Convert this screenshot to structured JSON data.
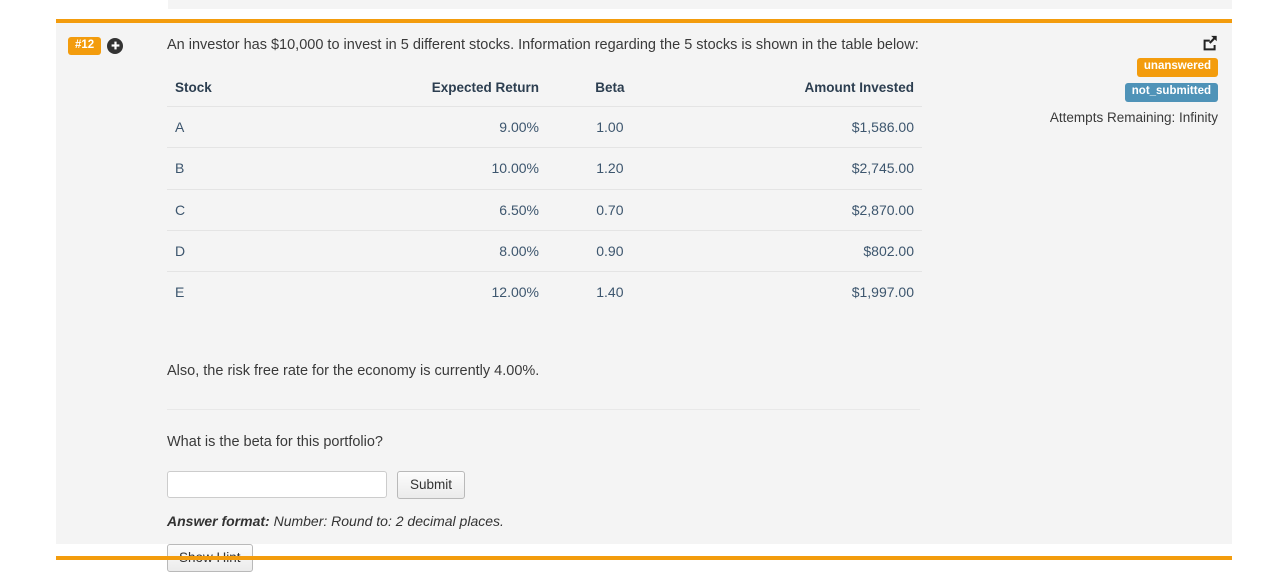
{
  "question": {
    "number_badge": "#12",
    "expand_icon": "plus-circle-icon",
    "intro": "An investor has $10,000 to invest in 5 different stocks. Information regarding the 5 stocks is shown in the table below:",
    "note": "Also, the risk free rate for the economy is currently 4.00%.",
    "prompt": "What is the beta for this portfolio?"
  },
  "table": {
    "headers": [
      "Stock",
      "Expected Return",
      "Beta",
      "Amount Invested"
    ],
    "rows": [
      {
        "stock": "A",
        "expected_return": "9.00%",
        "beta": "1.00",
        "amount_invested": "$1,586.00"
      },
      {
        "stock": "B",
        "expected_return": "10.00%",
        "beta": "1.20",
        "amount_invested": "$2,745.00"
      },
      {
        "stock": "C",
        "expected_return": "6.50%",
        "beta": "0.70",
        "amount_invested": "$2,870.00"
      },
      {
        "stock": "D",
        "expected_return": "8.00%",
        "beta": "0.90",
        "amount_invested": "$802.00"
      },
      {
        "stock": "E",
        "expected_return": "12.00%",
        "beta": "1.40",
        "amount_invested": "$1,997.00"
      }
    ]
  },
  "answer": {
    "input_value": "",
    "input_placeholder": "",
    "submit_label": "Submit",
    "format_label": "Answer format:",
    "format_text": " Number: Round to: 2 decimal places.",
    "hint_label": "Show Hint"
  },
  "status": {
    "share_icon": "share-external-icon",
    "answered_badge": "unanswered",
    "submitted_badge": "not_submitted",
    "attempts": "Attempts Remaining: Infinity"
  },
  "colors": {
    "accent_orange": "#f39c0d",
    "badge_blue": "#4f93b8",
    "panel_bg": "#f4f4f4",
    "text": "#3a3a3a"
  }
}
